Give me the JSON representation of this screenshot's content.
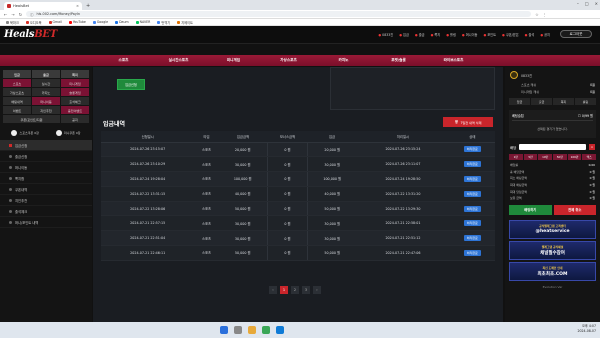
{
  "browser": {
    "tab_title": "HealsBet",
    "url": "hls-002.com/Money/PayIn",
    "bookmarks": [
      "북마크",
      "오디오북",
      "Gmail",
      "YouTube",
      "Google",
      "Daum",
      "NAVER",
      "번역기",
      "지메이트"
    ]
  },
  "site": {
    "logo_main": "Heals",
    "logo_accent": "BET",
    "top_links": [
      "0833진",
      "입금",
      "출금",
      "쪽지",
      "롤링",
      "머니이동",
      "포인트",
      "쿠폰/받은",
      "출석",
      "공지"
    ],
    "login_label": "로그아웃",
    "menu": [
      "스포츠",
      "실시간스포츠",
      "미니게임",
      "가상스포츠",
      "카지노",
      "포켓/슬롯",
      "라이브스포츠"
    ]
  },
  "left_sidebar": {
    "grid": [
      {
        "label": "입금",
        "style": "hd"
      },
      {
        "label": "출금",
        "style": "hd"
      },
      {
        "label": "쪽지",
        "style": "hd"
      },
      {
        "label": "스포츠",
        "style": "hi"
      },
      {
        "label": "실시간",
        "style": ""
      },
      {
        "label": "미니게임",
        "style": "hi"
      },
      {
        "label": "가상스포츠",
        "style": ""
      },
      {
        "label": "카지노",
        "style": ""
      },
      {
        "label": "슬롯게임",
        "style": "hi"
      },
      {
        "label": "배팅내역",
        "style": ""
      },
      {
        "label": "머니이동",
        "style": "hi"
      },
      {
        "label": "출석체크",
        "style": ""
      },
      {
        "label": "이벤트",
        "style": ""
      },
      {
        "label": "지인추천",
        "style": ""
      },
      {
        "label": "충전이벤트",
        "style": "hi"
      },
      {
        "label": "쿠폰/포인트/지원",
        "style": "w2"
      },
      {
        "label": "공지",
        "style": ""
      }
    ],
    "coupons": [
      {
        "label": "스포츠쿠폰",
        "value": "0장"
      },
      {
        "label": "미니쿠폰",
        "value": "0장"
      }
    ],
    "menu": [
      {
        "label": "입금신청",
        "active": true
      },
      {
        "label": "출금신청",
        "active": false
      },
      {
        "label": "머니이동",
        "active": false
      },
      {
        "label": "쪽지함",
        "active": false
      },
      {
        "label": "쿠폰내역",
        "active": false
      },
      {
        "label": "지인추천",
        "active": false
      },
      {
        "label": "출석체크",
        "active": false
      },
      {
        "label": "머니/포인트 내역",
        "active": false
      }
    ]
  },
  "main": {
    "charge_button": "입금신청",
    "section_title": "입금내역",
    "delete_button": "7일전 내역 삭제",
    "table": {
      "headers": [
        "신청일시",
        "타입",
        "입금금액",
        "보너스금액",
        "입금",
        "처리일시",
        "상태"
      ],
      "rows": [
        [
          "2024-07-26 23:15:07",
          "스포츠",
          "20,000 원",
          "0 원",
          "20,000 원",
          "2024-07-26 23:15:24",
          "처리완료"
        ],
        [
          "2024-07-26 23:10:29",
          "스포츠",
          "30,000 원",
          "0 원",
          "30,000 원",
          "2024-07-26 23:11:07",
          "처리완료"
        ],
        [
          "2024-07-24 19:28:04",
          "스포츠",
          "100,000 원",
          "0 원",
          "100,000 원",
          "2024-07-24 19:28:50",
          "처리완료"
        ],
        [
          "2024-07-22 13:31:15",
          "스포츠",
          "40,000 원",
          "0 원",
          "40,000 원",
          "2024-07-22 13:31:20",
          "처리완료"
        ],
        [
          "2024-07-22 13:28:06",
          "스포츠",
          "50,000 원",
          "0 원",
          "50,000 원",
          "2024-07-22 13:29:30",
          "처리완료"
        ],
        [
          "2024-07-21 22:57:15",
          "스포츠",
          "30,000 원",
          "0 원",
          "30,000 원",
          "2024-07-21 22:58:01",
          "처리완료"
        ],
        [
          "2024-07-21 22:51:04",
          "스포츠",
          "30,000 원",
          "0 원",
          "30,000 원",
          "2024-07-21 22:51:12",
          "처리완료"
        ],
        [
          "2024-07-21 22:46:11",
          "스포츠",
          "50,000 원",
          "0 원",
          "50,000 원",
          "2024-07-21 22:47:06",
          "처리완료"
        ]
      ]
    },
    "pager": [
      "‹",
      "1",
      "2",
      "3",
      "›"
    ]
  },
  "right_sidebar": {
    "user_name": "0833진",
    "lines": [
      {
        "label": "스포츠 캐쉬",
        "value": "0원"
      },
      {
        "label": "미니게임 캐쉬",
        "value": "0원"
      }
    ],
    "tabs": [
      "입금",
      "출금",
      "쪽지",
      "롤링"
    ],
    "box_title": "베팅슬립",
    "box_right": "☐ 0/99 원",
    "box_text": "선택된 경기가 없습니다.",
    "bet_label": "배당",
    "close_label": "×",
    "amount_buttons": [
      "1만",
      "5만",
      "10만",
      "50만",
      "100만",
      "맥스"
    ],
    "bet_rows": [
      {
        "label": "배당률",
        "value": "0.00"
      },
      {
        "label": "총 배당금액",
        "value": "0 원"
      },
      {
        "label": "최소 배팅금액",
        "value": "0 원"
      },
      {
        "label": "최대 배팅금액",
        "value": "0 원"
      },
      {
        "label": "최대 당첨금액",
        "value": "0 원"
      },
      {
        "label": "보유 금액",
        "value": "0 원"
      }
    ],
    "bet_button": "배팅하기",
    "reset_button": "전체 취소",
    "banners": [
      {
        "l1": "공식텔레그램 고객센터",
        "l2": "@heatservice"
      },
      {
        "l1": "텔레그램 공식채널",
        "l2": "채널필수참여"
      },
      {
        "l1": "최신 도메인 안내",
        "l2": "최초최초.COM"
      }
    ],
    "footer": "Evolution Ver"
  },
  "taskbar": {
    "time": "오후 4:07",
    "date": "2024-08-07"
  },
  "colors": {
    "accent": "#7b0f2a",
    "status": "#2d74d6",
    "danger": "#c9252b",
    "success": "#1f8a3b"
  }
}
